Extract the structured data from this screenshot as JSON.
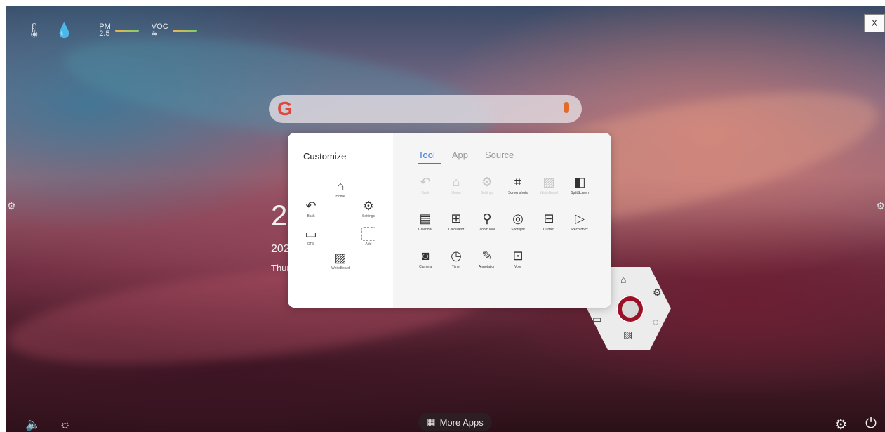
{
  "topbar": {
    "temperature_icon": "thermometer-icon",
    "humidity_icon": "droplet-icon",
    "pm_label": "PM",
    "pm_value": "2.5",
    "voc_label": "VOC",
    "close_label": "X"
  },
  "search": {
    "brand": "G",
    "mic_icon": "microphone-icon"
  },
  "clock": {
    "time": "2",
    "date": "202",
    "weekday": "Thur"
  },
  "dialog": {
    "title": "Customize",
    "preview_items": [
      {
        "label": "Home",
        "icon": "home-icon"
      },
      {
        "label": "Back",
        "icon": "back-icon"
      },
      {
        "label": "Settings",
        "icon": "settings-icon"
      },
      {
        "label": "OPS",
        "icon": "monitor-icon"
      },
      {
        "label": "Add",
        "icon": "add-icon"
      },
      {
        "label": "WhiteBoard",
        "icon": "whiteboard-icon"
      }
    ],
    "tabs": [
      "Tool",
      "App",
      "Source"
    ],
    "active_tab": "Tool",
    "tools": [
      {
        "label": "Back",
        "enabled": false
      },
      {
        "label": "Home",
        "enabled": false
      },
      {
        "label": "Settings",
        "enabled": false
      },
      {
        "label": "Screenshots",
        "enabled": true
      },
      {
        "label": "WhiteBoard",
        "enabled": false
      },
      {
        "label": "SplitScreen",
        "enabled": true
      },
      {
        "label": "Calendar",
        "enabled": true
      },
      {
        "label": "Calculator",
        "enabled": true
      },
      {
        "label": "ZoomTool",
        "enabled": true
      },
      {
        "label": "Spotlight",
        "enabled": true
      },
      {
        "label": "Curtain",
        "enabled": true
      },
      {
        "label": "RecordScr",
        "enabled": true
      },
      {
        "label": "Camera",
        "enabled": true
      },
      {
        "label": "Timer",
        "enabled": true
      },
      {
        "label": "Annotation",
        "enabled": true
      },
      {
        "label": "Vote",
        "enabled": true
      }
    ]
  },
  "bottom": {
    "more_apps_label": "More Apps"
  },
  "colors": {
    "accent": "#3a7bd5",
    "hub": "#9a1027"
  }
}
